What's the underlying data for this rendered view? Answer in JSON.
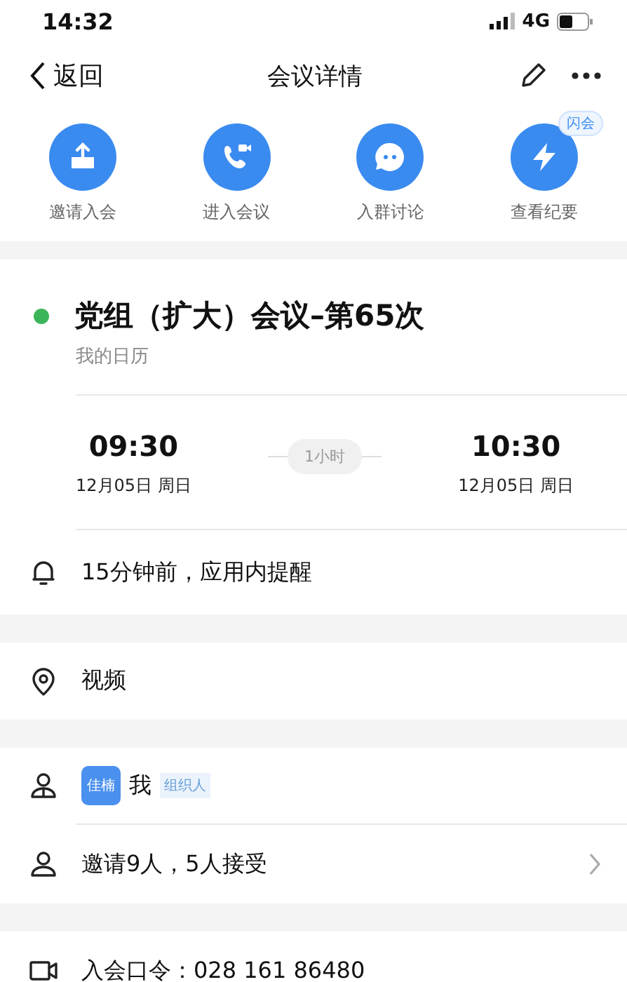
{
  "status_bar": {
    "time": "14:32",
    "network": "4G"
  },
  "nav": {
    "back": "返回",
    "title": "会议详情"
  },
  "actions": [
    {
      "kind": "invite",
      "label": "邀请入会"
    },
    {
      "kind": "join",
      "label": "进入会议"
    },
    {
      "kind": "chat",
      "label": "入群讨论"
    },
    {
      "kind": "minutes",
      "label": "查看纪要",
      "badge": "闪会"
    }
  ],
  "meeting": {
    "title": "党组（扩大）会议–第65次",
    "calendar": "我的日历",
    "color": "#3cb55a"
  },
  "time": {
    "start": "09:30",
    "start_date": "12月05日 周日",
    "duration": "1小时",
    "end": "10:30",
    "end_date": "12月05日 周日"
  },
  "reminder": "15分钟前，应用内提醒",
  "location": "视频",
  "organizer": {
    "avatar": "佳楠",
    "name": "我",
    "role": "组织人"
  },
  "invitees": "邀请9人，5人接受",
  "password": "入会口令：028 161 86480"
}
